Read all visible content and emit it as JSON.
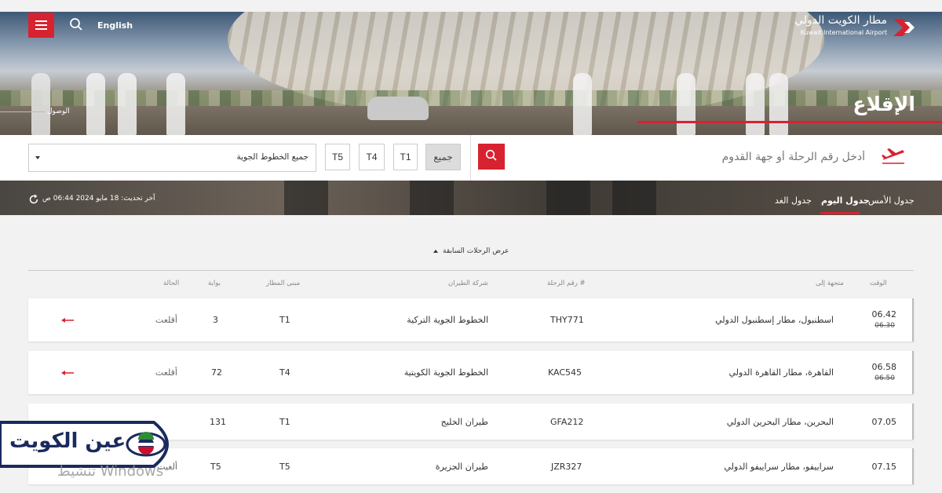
{
  "header": {
    "lang_label": "English",
    "logo_ar": "مطار الكويت الدولي",
    "logo_en": "Kuwait International Airport",
    "page_title": "الإقلاع",
    "arrivals_link": "الوصول"
  },
  "search": {
    "placeholder": "أدخل رقم الرحلة أو جهة القدوم"
  },
  "terminals": [
    {
      "label": "جميع",
      "active": true
    },
    {
      "label": "T1"
    },
    {
      "label": "T4"
    },
    {
      "label": "T5"
    }
  ],
  "airline_select": {
    "value": "جميع الخطوط الجوية"
  },
  "status_bar": {
    "last_updated": "آخر تحديث: 18 مايو 2024 06:44 ص"
  },
  "day_tabs": {
    "yesterday": "جدول الأمس",
    "today": "جدول اليوم",
    "tomorrow": "جدول الغد"
  },
  "show_previous": "عرض الرحلات السابقة",
  "columns": {
    "time": "الوقت",
    "destination": "متجهة إلى",
    "flight": "رقم الرحلة #",
    "airline": "شركة الطيران",
    "terminal": "مبنى المطار",
    "gate": "بوابة",
    "status": "الحالة"
  },
  "flights": [
    {
      "time": "06.42",
      "scheduled": "06.30",
      "destination": "اسطنبول، مطار إسطنبول الدولي",
      "flight": "THY771",
      "airline": "الخطوط الجوية التركية",
      "terminal": "T1",
      "gate": "3",
      "status": "أقلعت"
    },
    {
      "time": "06.58",
      "scheduled": "06.50",
      "destination": "القاهرة، مطار القاهرة الدولي",
      "flight": "KAC545",
      "airline": "الخطوط الجوية الكويتية",
      "terminal": "T4",
      "gate": "72",
      "status": "أقلعت"
    },
    {
      "time": "07.05",
      "scheduled": "",
      "destination": "البحرين، مطار البحرين الدولي",
      "flight": "GFA212",
      "airline": "طيران الخليج",
      "terminal": "T1",
      "gate": "131",
      "status": ""
    },
    {
      "time": "07.15",
      "scheduled": "",
      "destination": "سراييفو، مطار سراييفو الدولي",
      "flight": "JZR327",
      "airline": "طيران الجزيرة",
      "terminal": "T5",
      "gate": "T5",
      "status": "ألغيت"
    }
  ],
  "overlay": {
    "brand": "عين الكويت",
    "watermark": "تنشيط Windows"
  },
  "colors": {
    "accent": "#d7232f",
    "brand_navy": "#1a2a5e"
  }
}
